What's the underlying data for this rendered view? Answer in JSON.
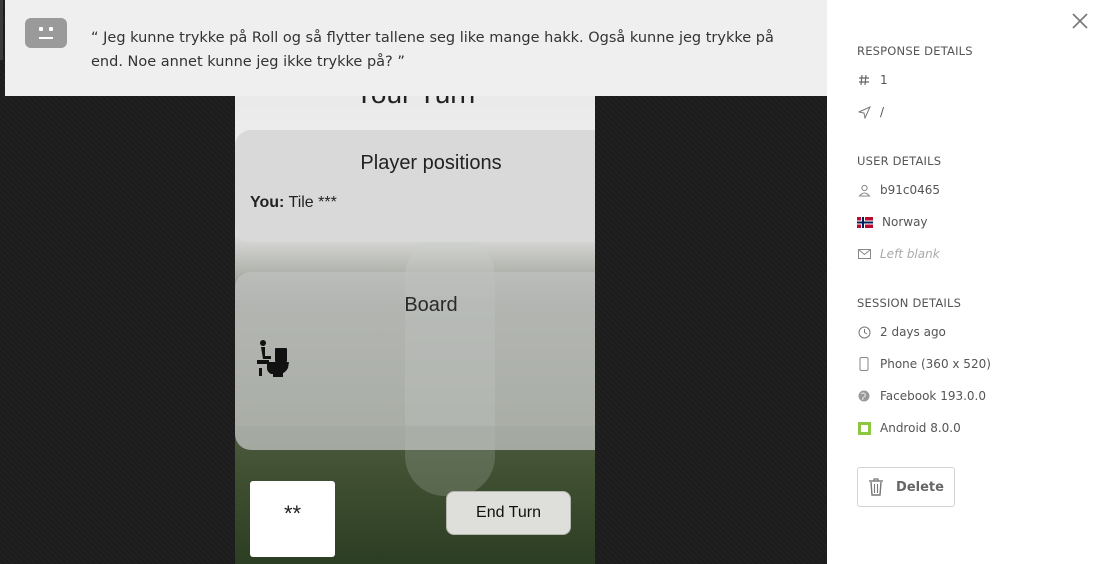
{
  "feedback": {
    "quote": "“ Jeg kunne trykke på Roll og så flytter tallene seg like mange hakk. Også kunne jeg trykke på end. Noe annet kunne jeg ikke trykke på? ”"
  },
  "phone_screen": {
    "header": "Your Turn",
    "positions_title": "Player positions",
    "player_label": "You:",
    "player_value": "Tile ***",
    "board_title": "Board",
    "dice_value": "**",
    "end_turn_label": "End Turn",
    "board_icon": "toilet-icon"
  },
  "details": {
    "response_heading": "RESPONSE DETAILS",
    "response_number": "1",
    "response_path": "/",
    "user_heading": "USER DETAILS",
    "user_id": "b91c0465",
    "country": "Norway",
    "email": "Left blank",
    "session_heading": "SESSION DETAILS",
    "time_ago": "2 days ago",
    "device": "Phone (360 x 520)",
    "browser": "Facebook 193.0.0",
    "os": "Android 8.0.0",
    "delete_label": "Delete"
  },
  "colors": {
    "panel_bg": "#ffffff",
    "feedback_bg": "#efefef",
    "backdrop": "#1c1c1c",
    "android_green": "#8dc63f"
  }
}
